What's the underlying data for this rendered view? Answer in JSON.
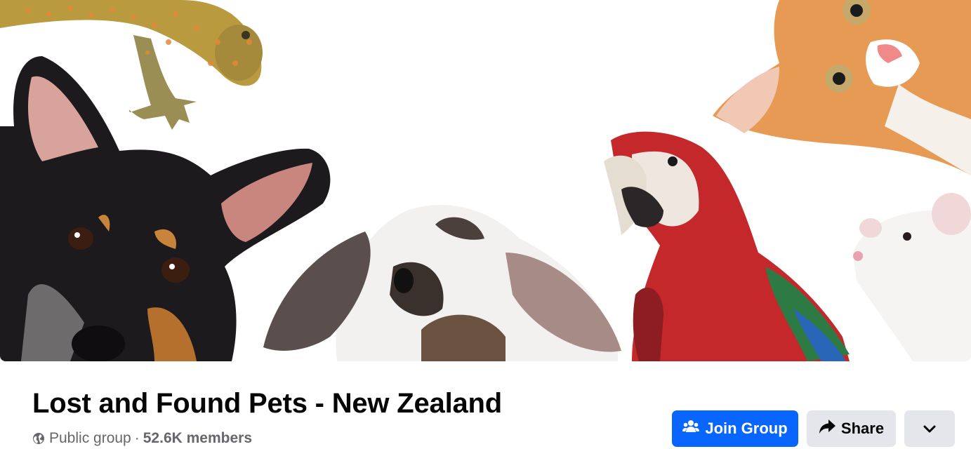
{
  "cover": {
    "alt_subjects": [
      "gecko-image",
      "dog-image",
      "rabbit-image",
      "parrot-image",
      "kitten-image",
      "mouse-image"
    ]
  },
  "group": {
    "name": "Lost and Found Pets - New Zealand",
    "privacy": "Public group",
    "separator": "·",
    "members": "52.6K members"
  },
  "actions": {
    "join_label": "Join Group",
    "share_label": "Share"
  },
  "icons": {
    "privacy": "globe-icon",
    "join": "people-icon",
    "share": "share-arrow-icon",
    "more": "chevron-down-icon"
  },
  "colors": {
    "primary_button": "#0866ff",
    "secondary_button": "#e4e6eb",
    "title_text": "#050505",
    "meta_text": "#65676b"
  }
}
